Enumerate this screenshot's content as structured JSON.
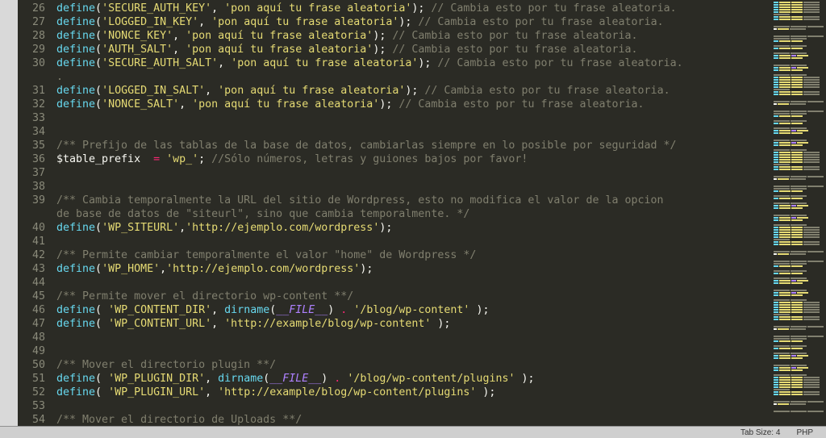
{
  "statusbar": {
    "tab_size": "Tab Size: 4",
    "syntax": "PHP"
  },
  "strings": {
    "frase": "'pon aquí tu frase aleatoria'",
    "comment_cambia": "// Cambia esto por tu frase aleatoria.",
    "wp_": "'wp_'",
    "siteurl": "'http://ejemplo.com/wordpress'",
    "homeurl": "'http://ejemplo.com/wordpress'",
    "blog_wp_content": "'/blog/wp-content'",
    "content_url": "'http://example/blog/wp-content'",
    "blog_plugins": "'/blog/wp-content/plugins'",
    "plugin_url": "'http://example/blog/wp-content/plugins'"
  },
  "consts": {
    "secure_auth_key": "'SECURE_AUTH_KEY'",
    "logged_in_key": "'LOGGED_IN_KEY'",
    "nonce_key": "'NONCE_KEY'",
    "auth_salt": "'AUTH_SALT'",
    "secure_auth_salt": "'SECURE_AUTH_SALT'",
    "logged_in_salt": "'LOGGED_IN_SALT'",
    "nonce_salt": "'NONCE_SALT'",
    "wp_siteurl": "'WP_SITEURL'",
    "wp_home": "'WP_HOME'",
    "wp_content_dir": "'WP_CONTENT_DIR'",
    "wp_content_url": "'WP_CONTENT_URL'",
    "wp_plugin_dir": "'WP_PLUGIN_DIR'",
    "wp_plugin_url": "'WP_PLUGIN_URL'"
  },
  "kw": {
    "define": "define",
    "dirname": "dirname",
    "file": "__FILE__"
  },
  "vars": {
    "table_prefix": "$table_prefix"
  },
  "comments": {
    "prefijo": "/** Prefijo de las tablas de la base de datos, cambiarlas siempre en lo posible por seguridad */",
    "solo_num": "//Sólo números, letras y guiones bajos por favor!",
    "cambia_url1": "/** Cambia temporalmente la URL del sitio de Wordpress, esto no modifica el valor de la opcion",
    "cambia_url2": "de base de datos de \"siteurl\", sino que cambia temporalmente. */",
    "permite_home": "/** Permite cambiar temporalmente el valor \"home\" de Wordpress */",
    "permite_wpcontent": "/** Permite mover el directorio wp-content **/",
    "mover_plugin": "/** Mover el directorio plugin **/",
    "mover_uploads": "/** Mover el directorio de Uploads **/",
    "dot": "."
  },
  "lnum": {
    "26": "26",
    "27": "27",
    "28": "28",
    "29": "29",
    "30": "30",
    "31": "31",
    "32": "32",
    "33": "33",
    "34": "34",
    "35": "35",
    "36": "36",
    "37": "37",
    "38": "38",
    "39": "39",
    "40": "40",
    "41": "41",
    "42": "42",
    "43": "43",
    "44": "44",
    "45": "45",
    "46": "46",
    "47": "47",
    "48": "48",
    "49": "49",
    "50": "50",
    "51": "51",
    "52": "52",
    "53": "53",
    "54": "54"
  }
}
